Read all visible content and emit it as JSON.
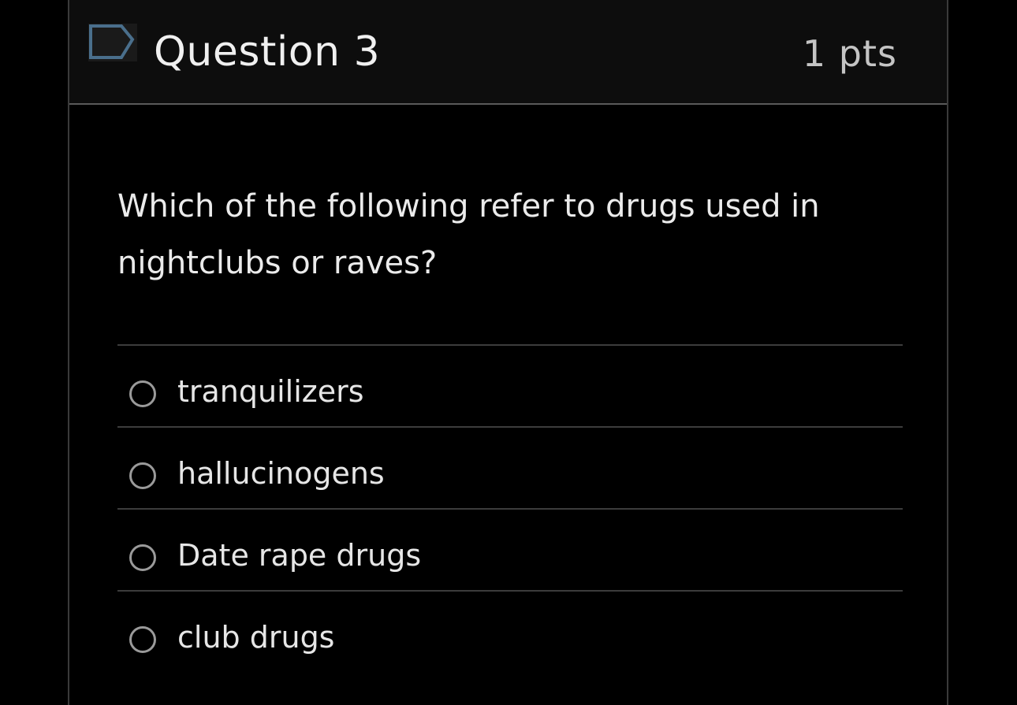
{
  "question": {
    "title": "Question 3",
    "points": "1 pts",
    "text": "Which of the following refer to drugs used in nightclubs or raves?",
    "flag_icon": "flag-icon"
  },
  "answers": [
    {
      "label": "tranquilizers",
      "selected": false
    },
    {
      "label": "hallucinogens",
      "selected": false
    },
    {
      "label": "Date rape drugs",
      "selected": false
    },
    {
      "label": "club drugs",
      "selected": false
    }
  ],
  "colors": {
    "background": "#000000",
    "header_background": "#0d0d0d",
    "text": "#ebebeb",
    "flag_outline": "#4a6f8c"
  }
}
